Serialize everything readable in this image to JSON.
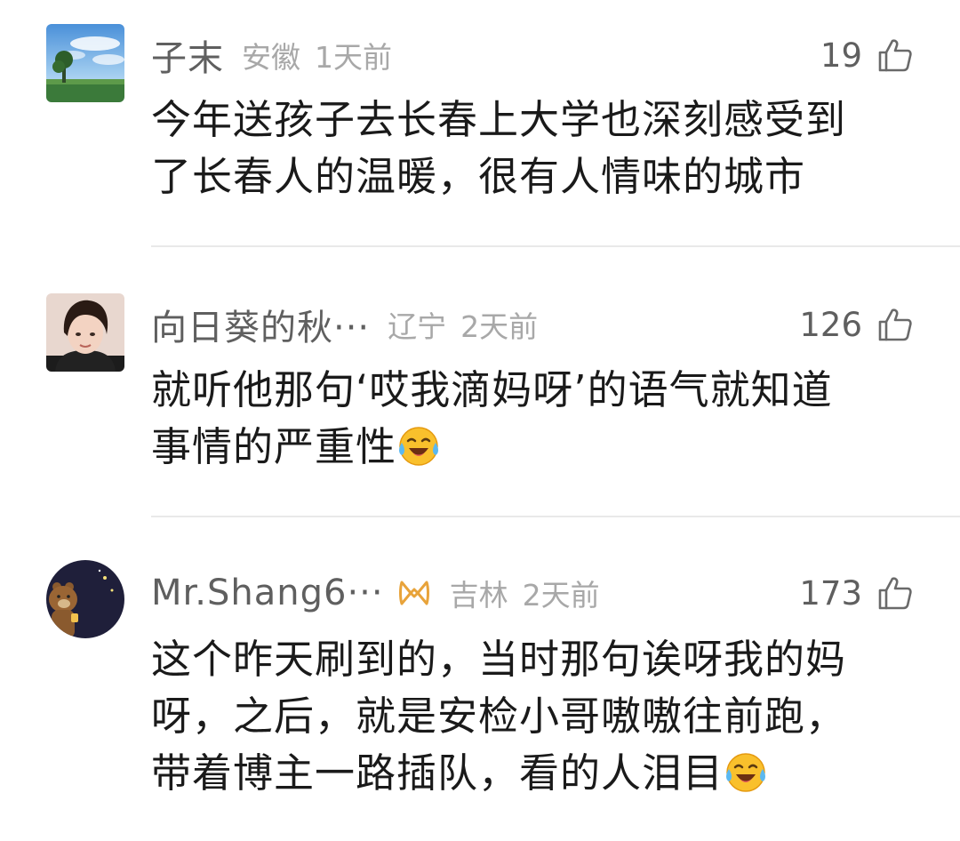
{
  "comments": [
    {
      "username": "子末",
      "location": "安徽",
      "time": "1天前",
      "likes": "19",
      "text_line1": "今年送孩子去长春上大学也深刻感受到",
      "text_line2": "了长春人的温暖，很有人情味的城市"
    },
    {
      "username": "向日葵的秋···",
      "location": "辽宁",
      "time": "2天前",
      "likes": "126",
      "text_line1": "就听他那句‘哎我滴妈呀’的语气就知道",
      "text_line2": "事情的严重性"
    },
    {
      "username": "Mr.Shang6···",
      "location": "吉林",
      "time": "2天前",
      "likes": "173",
      "text_line1": "这个昨天刷到的，当时那句诶呀我的妈",
      "text_line2": "呀，之后，就是安检小哥嗷嗷往前跑，",
      "text_line3": "带着博主一路插队，看的人泪目"
    }
  ],
  "icons": {
    "like": "thumbs-up-outline-icon",
    "emoji": "crying-laughing-emoji",
    "badge": "vip-badge-icon"
  },
  "colors": {
    "username": "#5f5f5f",
    "meta": "#a8a8a8",
    "body_text": "#1a1a1a",
    "divider": "#e9e9e9",
    "badge": "#e8a33a"
  }
}
